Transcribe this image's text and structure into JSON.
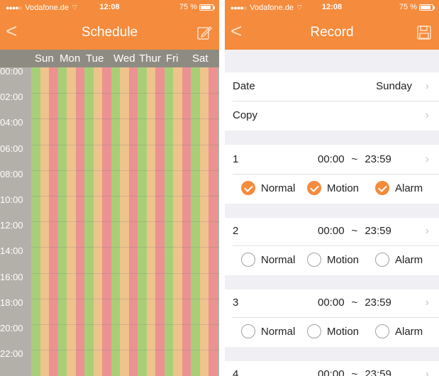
{
  "status": {
    "carrier": "Vodafone.de",
    "time": "12:08",
    "battery": "75 %"
  },
  "schedule": {
    "back": "<",
    "title": "Schedule",
    "edit_icon": "edit-icon",
    "days": [
      "Sun",
      "Mon",
      "Tue",
      "Wed",
      "Thur",
      "Fri",
      "Sat"
    ],
    "times": [
      "00:00",
      "02:00",
      "04:00",
      "06:00",
      "08:00",
      "10:00",
      "12:00",
      "14:00",
      "16:00",
      "18:00",
      "20:00",
      "22:00"
    ],
    "stripe_colors": {
      "normal": "#a8cf78",
      "motion": "#efc38c",
      "alarm": "#ec9292",
      "header": "#8e8c82",
      "time": "#b2b0a8"
    }
  },
  "record": {
    "back": "<",
    "title": "Record",
    "save_icon": "save-icon",
    "date_label": "Date",
    "date_value": "Sunday",
    "copy_label": "Copy",
    "tilde": "~",
    "slots": [
      {
        "index": "1",
        "start": "00:00",
        "end": "23:59",
        "normal": "Normal",
        "motion": "Motion",
        "alarm": "Alarm",
        "checked": true
      },
      {
        "index": "2",
        "start": "00:00",
        "end": "23:59",
        "normal": "Normal",
        "motion": "Motion",
        "alarm": "Alarm",
        "checked": false
      },
      {
        "index": "3",
        "start": "00:00",
        "end": "23:59",
        "normal": "Normal",
        "motion": "Motion",
        "alarm": "Alarm",
        "checked": false
      },
      {
        "index": "4",
        "start": "00:00",
        "end": "23:59"
      }
    ],
    "accent": "#f58b3c"
  }
}
